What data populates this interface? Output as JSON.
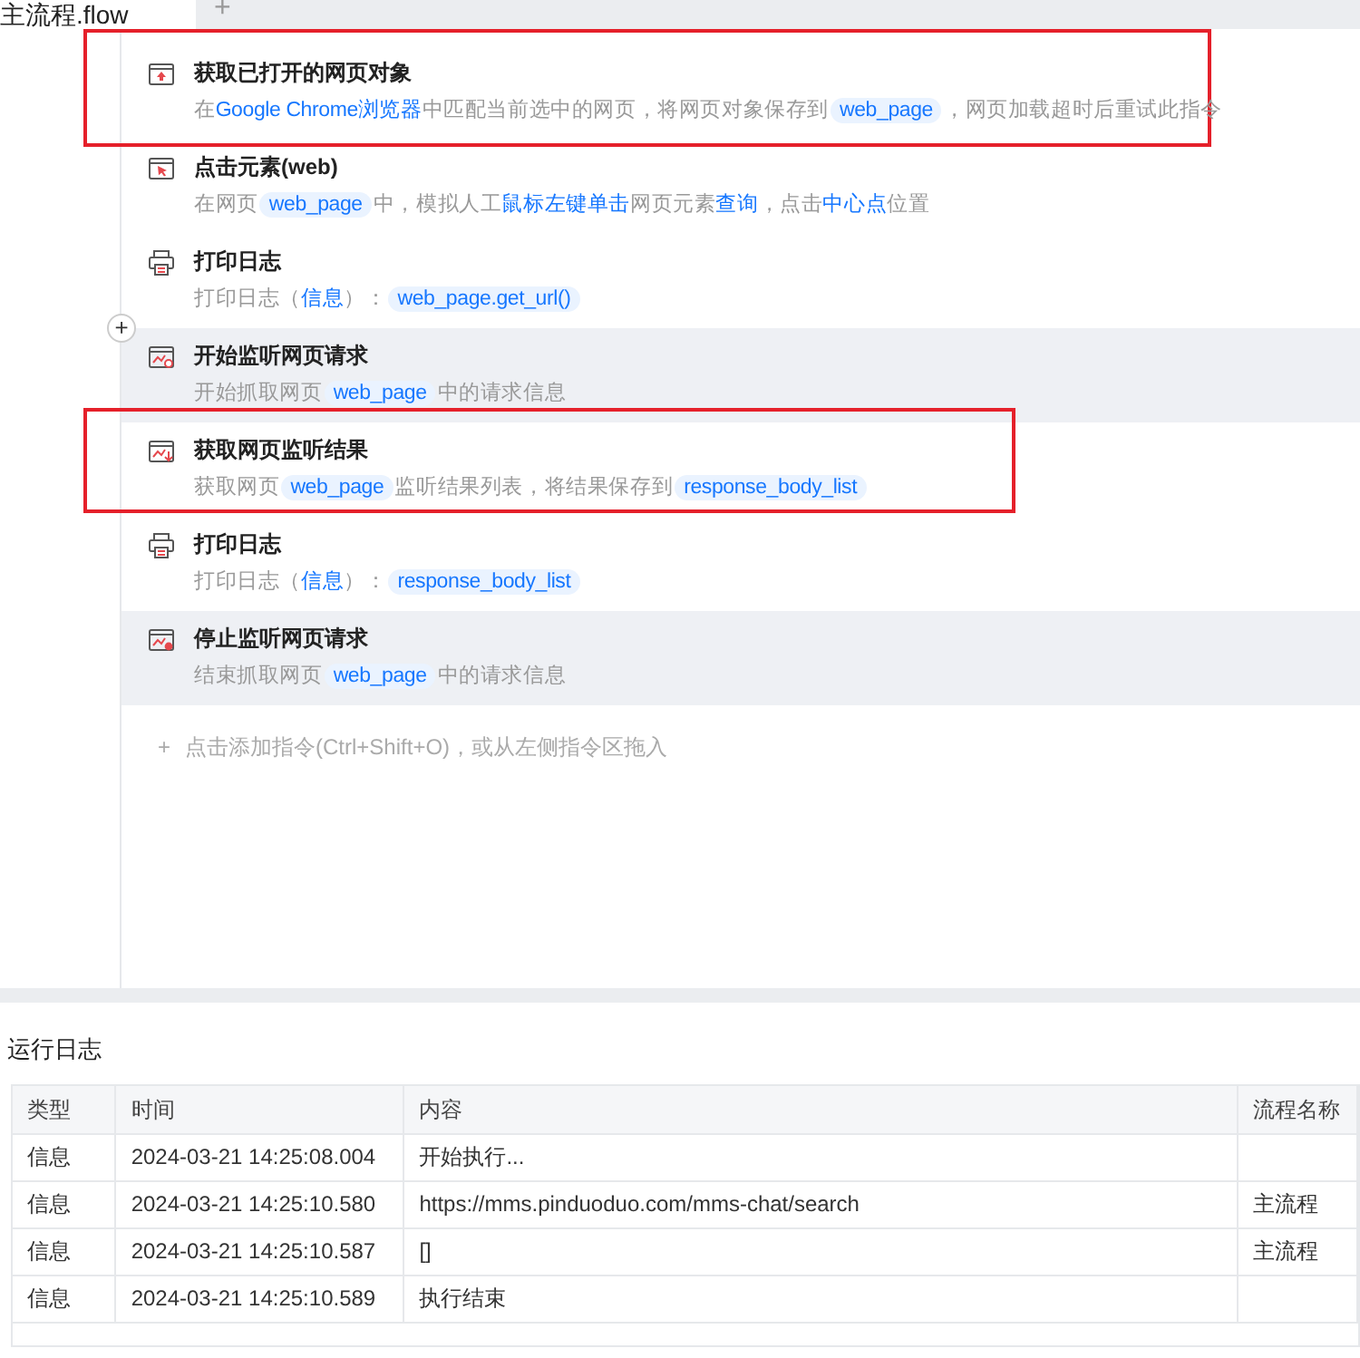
{
  "tabs": [
    {
      "label": "主流程.flow",
      "selected": true
    }
  ],
  "new_tab": "+",
  "steps": [
    {
      "kind": "browser",
      "title": "获取已打开的网页对象",
      "highlighted": false,
      "annotated": true,
      "description": [
        {
          "kind": "text",
          "text": "在"
        },
        {
          "kind": "link",
          "text": "Google Chrome浏览器"
        },
        {
          "kind": "text",
          "text": "中匹配当前选中的网页，将网页对象保存到"
        },
        {
          "kind": "var",
          "text": "web_page"
        },
        {
          "kind": "text",
          "text": "，网页加载超时后重试此指令"
        }
      ]
    },
    {
      "kind": "click",
      "title": "点击元素(web)",
      "highlighted": false,
      "annotated": false,
      "description": [
        {
          "kind": "text",
          "text": "在网页"
        },
        {
          "kind": "var",
          "text": "web_page"
        },
        {
          "kind": "text",
          "text": "中，模拟人工"
        },
        {
          "kind": "link",
          "text": "鼠标左键单击"
        },
        {
          "kind": "text",
          "text": "网页元素"
        },
        {
          "kind": "link",
          "text": "查询"
        },
        {
          "kind": "text",
          "text": "，点击"
        },
        {
          "kind": "link",
          "text": "中心点"
        },
        {
          "kind": "text",
          "text": "位置"
        }
      ]
    },
    {
      "kind": "printer",
      "title": "打印日志",
      "highlighted": false,
      "annotated": false,
      "description": [
        {
          "kind": "text",
          "text": "打印日志（"
        },
        {
          "kind": "link",
          "text": "信息"
        },
        {
          "kind": "text",
          "text": "）："
        },
        {
          "kind": "var",
          "text": "web_page.get_url()"
        }
      ]
    },
    {
      "kind": "monitor-start",
      "title": "开始监听网页请求",
      "highlighted": true,
      "annotated": false,
      "description": [
        {
          "kind": "text",
          "text": "开始抓取网页"
        },
        {
          "kind": "var",
          "text": "web_page"
        },
        {
          "kind": "text",
          "text": "中的请求信息"
        }
      ]
    },
    {
      "kind": "monitor-result",
      "title": "获取网页监听结果",
      "highlighted": false,
      "annotated": true,
      "description": [
        {
          "kind": "text",
          "text": "获取网页"
        },
        {
          "kind": "var",
          "text": "web_page"
        },
        {
          "kind": "text",
          "text": "监听结果列表，将结果保存到"
        },
        {
          "kind": "var",
          "text": "response_body_list"
        }
      ]
    },
    {
      "kind": "printer",
      "title": "打印日志",
      "highlighted": false,
      "annotated": false,
      "description": [
        {
          "kind": "text",
          "text": "打印日志（"
        },
        {
          "kind": "link",
          "text": "信息"
        },
        {
          "kind": "text",
          "text": "）："
        },
        {
          "kind": "var",
          "text": "response_body_list"
        }
      ]
    },
    {
      "kind": "monitor-stop",
      "title": "停止监听网页请求",
      "highlighted": true,
      "annotated": false,
      "description": [
        {
          "kind": "text",
          "text": "结束抓取网页"
        },
        {
          "kind": "var",
          "text": "web_page"
        },
        {
          "kind": "text",
          "text": "中的请求信息"
        }
      ]
    }
  ],
  "insert_button": "+",
  "add_hint": {
    "icon": "+",
    "text": "点击添加指令(Ctrl+Shift+O)，或从左侧指令区拖入"
  },
  "log": {
    "title": "运行日志",
    "columns": [
      "类型",
      "时间",
      "内容",
      "流程名称"
    ],
    "rows": [
      {
        "type": "信息",
        "time": "2024-03-21 14:25:08.004",
        "content": "开始执行..."
      },
      {
        "type": "信息",
        "time": "2024-03-21 14:25:10.580",
        "content": "https://mms.pinduoduo.com/mms-chat/search",
        "flow": "主流程"
      },
      {
        "type": "信息",
        "time": "2024-03-21 14:25:10.587",
        "content": "[]",
        "flow": "主流程"
      },
      {
        "type": "信息",
        "time": "2024-03-21 14:25:10.589",
        "content": "执行结束"
      }
    ]
  }
}
